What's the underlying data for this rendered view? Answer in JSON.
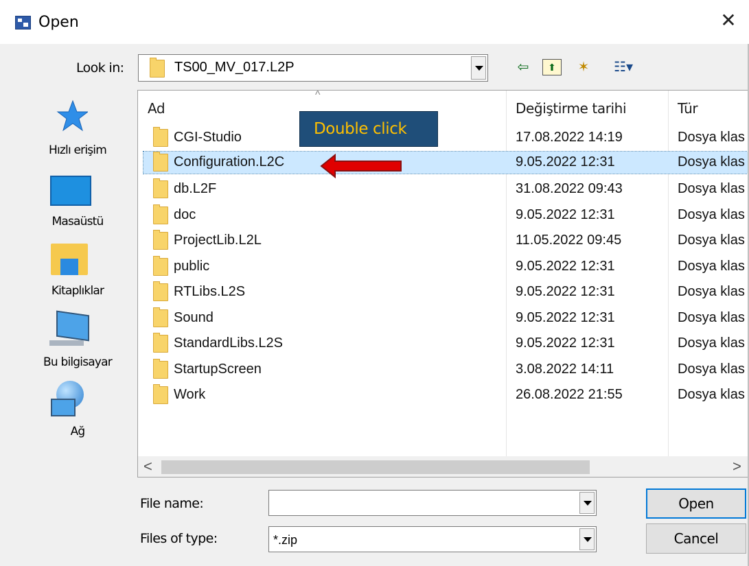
{
  "dialog": {
    "title": "Open",
    "close_glyph": "✕"
  },
  "look_in": {
    "label": "Look in:",
    "value": "TS00_MV_017.L2P"
  },
  "toolbar": [
    {
      "name": "back-icon",
      "glyph": "⇦"
    },
    {
      "name": "up-folder-icon",
      "glyph": "⬆"
    },
    {
      "name": "new-folder-icon",
      "glyph": "✶"
    },
    {
      "name": "view-menu-icon",
      "glyph": "☷▾"
    }
  ],
  "places": [
    {
      "label": "Hızlı erişim",
      "icon": "quick-access-star-icon"
    },
    {
      "label": "Masaüstü",
      "icon": "desktop-icon"
    },
    {
      "label": "Kitaplıklar",
      "icon": "libraries-icon"
    },
    {
      "label": "Bu bilgisayar",
      "icon": "this-pc-icon"
    },
    {
      "label": "Ağ",
      "icon": "network-icon"
    }
  ],
  "columns": [
    "Ad",
    "Değiştirme tarihi",
    "Tür"
  ],
  "files": [
    {
      "name": "CGI-Studio",
      "date": "17.08.2022 14:19",
      "type": "Dosya klas"
    },
    {
      "name": "Configuration.L2C",
      "date": "9.05.2022 12:31",
      "type": "Dosya klas",
      "selected": true
    },
    {
      "name": "db.L2F",
      "date": "31.08.2022 09:43",
      "type": "Dosya klas"
    },
    {
      "name": "doc",
      "date": "9.05.2022 12:31",
      "type": "Dosya klas"
    },
    {
      "name": "ProjectLib.L2L",
      "date": "11.05.2022 09:45",
      "type": "Dosya klas"
    },
    {
      "name": "public",
      "date": "9.05.2022 12:31",
      "type": "Dosya klas"
    },
    {
      "name": "RTLibs.L2S",
      "date": "9.05.2022 12:31",
      "type": "Dosya klas"
    },
    {
      "name": "Sound",
      "date": "9.05.2022 12:31",
      "type": "Dosya klas"
    },
    {
      "name": "StandardLibs.L2S",
      "date": "9.05.2022 12:31",
      "type": "Dosya klas"
    },
    {
      "name": "StartupScreen",
      "date": "3.08.2022 14:11",
      "type": "Dosya klas"
    },
    {
      "name": "Work",
      "date": "26.08.2022 21:55",
      "type": "Dosya klas"
    }
  ],
  "annotation": {
    "text": "Double click",
    "bg": "#1f4e79",
    "fg": "#ffc000",
    "arrow_color": "#e00000"
  },
  "file_name": {
    "label": "File name:",
    "value": ""
  },
  "file_type": {
    "label": "Files of type:",
    "value": "*.zip"
  },
  "buttons": {
    "open": "Open",
    "cancel": "Cancel"
  },
  "scroll": {
    "left": "<",
    "right": ">"
  }
}
